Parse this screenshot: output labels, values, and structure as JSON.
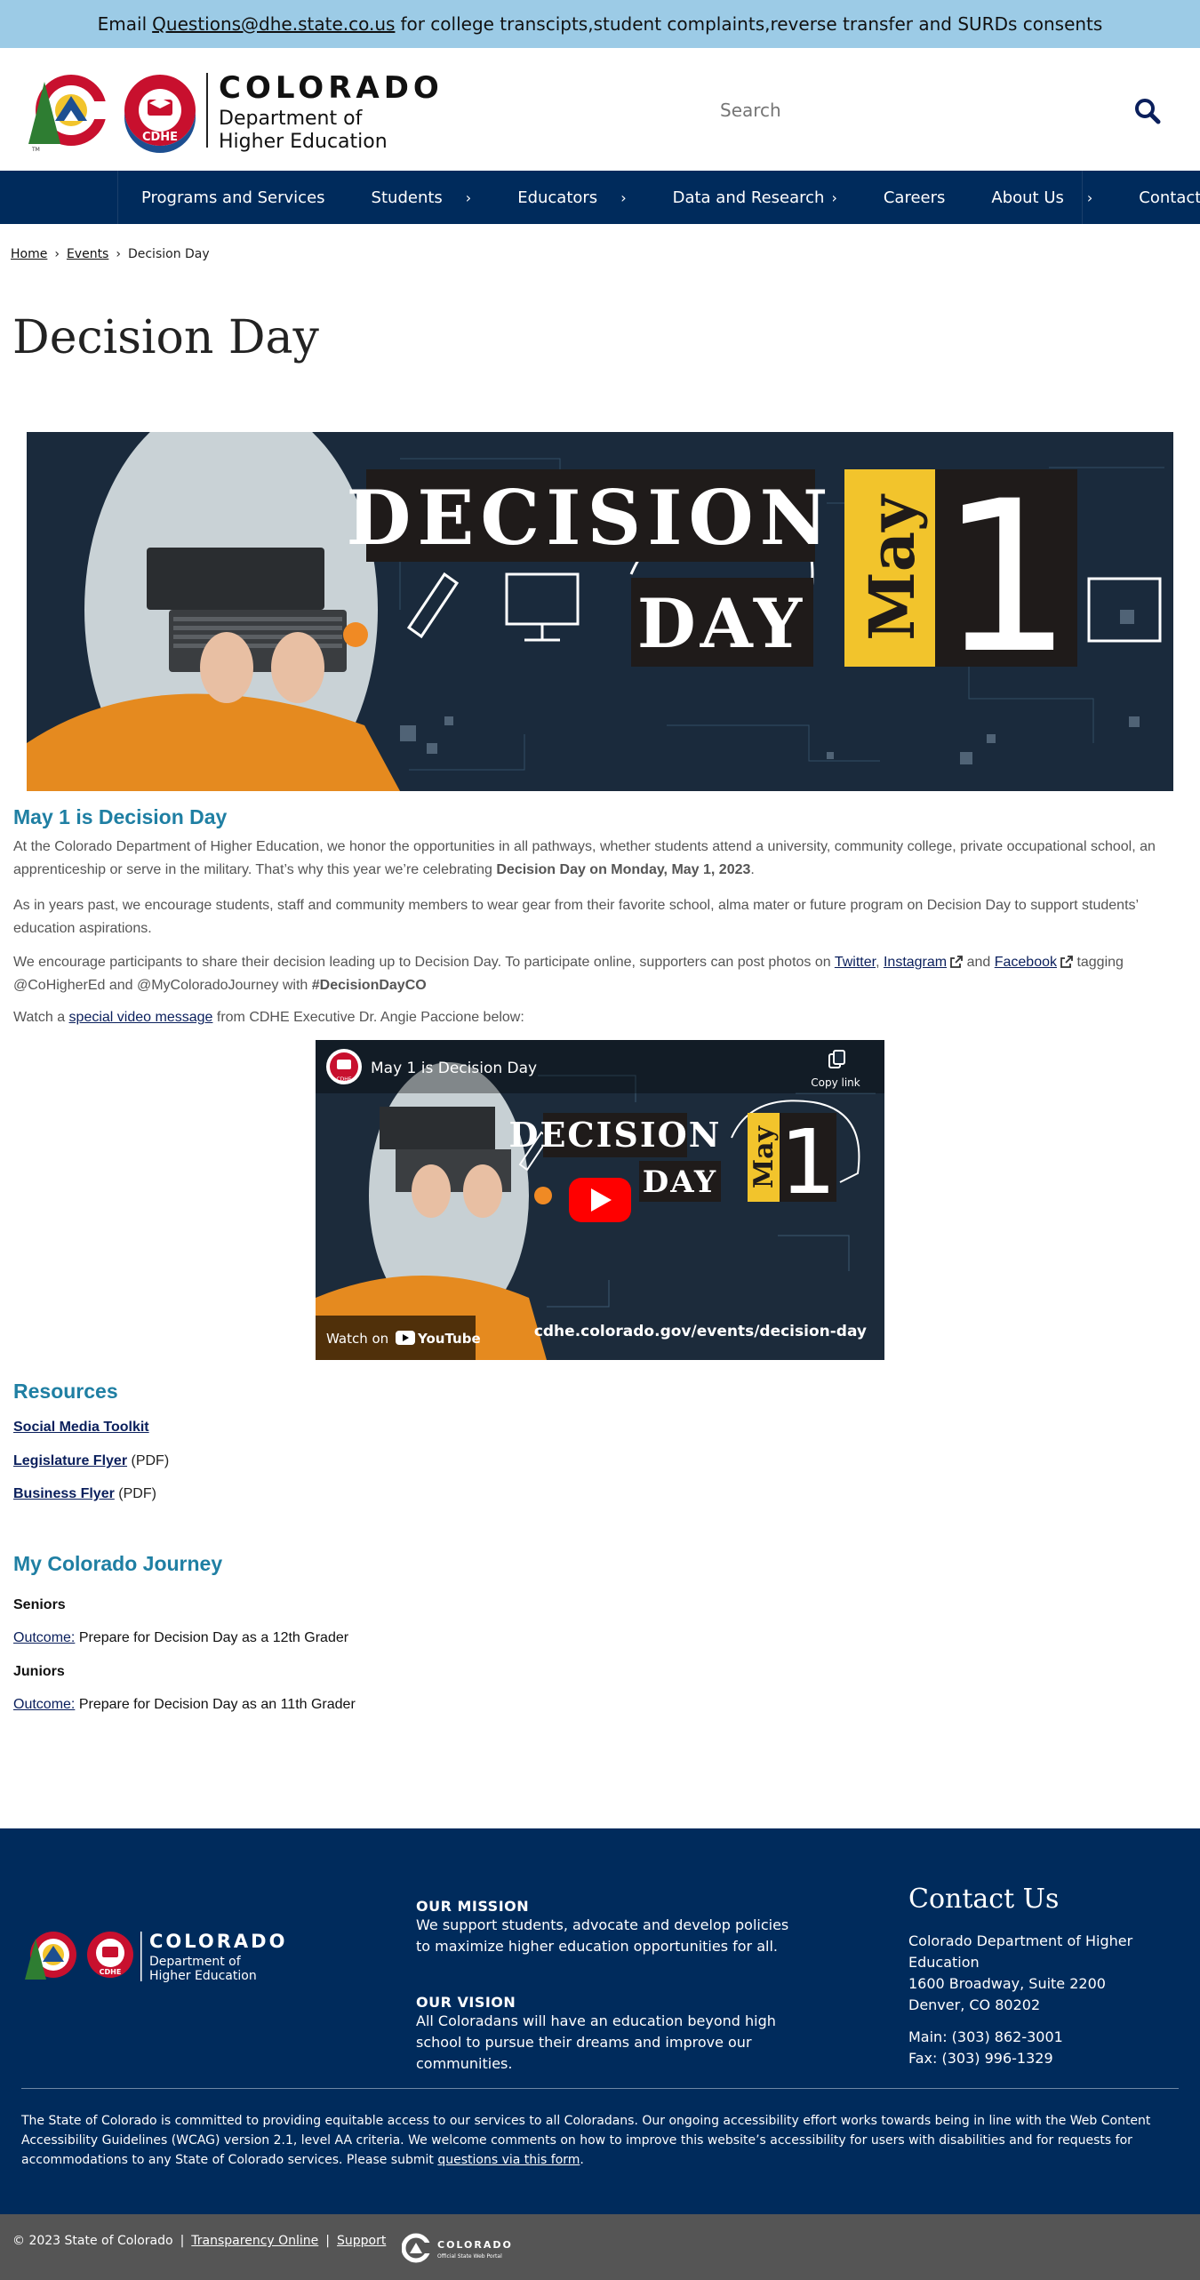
{
  "banner": {
    "prefix": "Email",
    "email": "Questions@dhe.state.co.us",
    "suffix": "for college transcipts,student complaints,reverse transfer and SURDs consents"
  },
  "header": {
    "logo_word": "COLORADO",
    "logo_line1": "Department of",
    "logo_line2": "Higher Education",
    "logo_badge": "CDHE",
    "logo_tm": "TM",
    "search_placeholder": "Search",
    "search_icon": "search-icon"
  },
  "nav": {
    "items": [
      {
        "label": "Programs and Services",
        "has_children": false
      },
      {
        "label": "Students",
        "has_children": true
      },
      {
        "label": "Educators",
        "has_children": true
      },
      {
        "label": "Data and Research",
        "has_children": true
      },
      {
        "label": "Careers",
        "has_children": false
      },
      {
        "label": "About Us",
        "has_children": true
      },
      {
        "label": "Contact Us",
        "has_children": false
      }
    ],
    "chevron": "›"
  },
  "breadcrumb": {
    "home": "Home",
    "events": "Events",
    "current": "Decision Day",
    "separator": "›"
  },
  "page": {
    "title": "Decision Day"
  },
  "hero": {
    "word1": "DECISION",
    "word2": "DAY",
    "month": "May",
    "day": "1"
  },
  "intro": {
    "heading": "May 1 is Decision Day",
    "p1_text": "At the Colorado Department of Higher Education, we honor the opportunities in all pathways, whether students attend a university, community college, private occupational school, an apprenticeship or serve in the military. That’s why this year we’re celebrating",
    "p1_bold": "Decision Day on Monday, May 1, 2023",
    "p1_end": ".",
    "p2": "As in years past, we encourage students, staff and community members to wear gear from their favorite school, alma mater or future program on Decision Day to support students’ education aspirations.",
    "p3_a": "We encourage participants to share their decision leading up to Decision Day. To participate online, supporters can post photos on",
    "twitter": "Twitter",
    "comma": ",",
    "instagram": "Instagram",
    "and": "and",
    "facebook": "Facebook",
    "p3_b": "tagging @CoHigherEd and @MyColoradoJourney with",
    "hashtag": "#DecisionDayCO",
    "p4_a": "Watch a",
    "video_link": "special video message",
    "p4_b": "from CDHE Executive Dr. Angie Paccione below:"
  },
  "video": {
    "title": "May 1 is Decision Day",
    "copy_link": "Copy link",
    "watch_on": "Watch on",
    "youtube": "YouTube",
    "url_text": "cdhe.colorado.gov/events/decision-day",
    "channel_badge": "CDHE",
    "word1": "DECISION",
    "word2": "DAY",
    "month": "May",
    "day": "1"
  },
  "resources": {
    "heading": "Resources",
    "items": [
      {
        "label": "Social Media Toolkit",
        "note": ""
      },
      {
        "label": "Legislature Flyer",
        "note": "(PDF)"
      },
      {
        "label": "Business Flyer",
        "note": "(PDF)"
      }
    ]
  },
  "journey": {
    "heading": "My Colorado Journey",
    "groups": [
      {
        "label": "Seniors",
        "link": "Outcome:",
        "text": "Prepare for Decision Day as a 12th Grader"
      },
      {
        "label": "Juniors",
        "link": "Outcome:",
        "text": "Prepare for Decision Day as an 11th Grader"
      }
    ]
  },
  "footer": {
    "logo_word": "COLORADO",
    "logo_line1": "Department of",
    "logo_line2": "Higher Education",
    "logo_badge": "CDHE",
    "mission_title": "OUR MISSION",
    "mission_text": "We support students, advocate and develop policies to maximize higher education opportunities for all.",
    "vision_title": "OUR VISION",
    "vision_text": "All Coloradans will have an education beyond high school to pursue their dreams and improve our communities.",
    "contact_title": "Contact Us",
    "org": "Colorado Department of Higher Education",
    "address1": "1600 Broadway, Suite 2200",
    "address2": "Denver, CO 80202",
    "main": "Main: (303) 862-3001",
    "fax": "Fax: (303) 996-1329",
    "access_text": "The State of Colorado is committed to providing equitable access to our services to all Coloradans. Our ongoing accessibility effort works towards being in line with the Web Content Accessibility Guidelines (WCAG) version 2.1, level AA criteria. We welcome comments on how to improve this website’s accessibility for users with disabilities and for requests for accommodations to any State of Colorado services. Please submit",
    "access_link": "questions via this form",
    "access_end": "."
  },
  "bottom": {
    "copyright": "© 2023 State of Colorado",
    "transparency": "Transparency Online",
    "support": "Support",
    "pipe": "|",
    "portal_word": "COLORADO",
    "portal_sub": "Official State Web Portal"
  },
  "colors": {
    "banner": "#9ccbe6",
    "nav": "#002b5c",
    "heading": "#1f7fa3",
    "link": "#0a1f5c",
    "footer": "#002b5c",
    "bottom": "#555555",
    "brand_red": "#c8102e",
    "brand_yellow": "#f2c42c"
  }
}
